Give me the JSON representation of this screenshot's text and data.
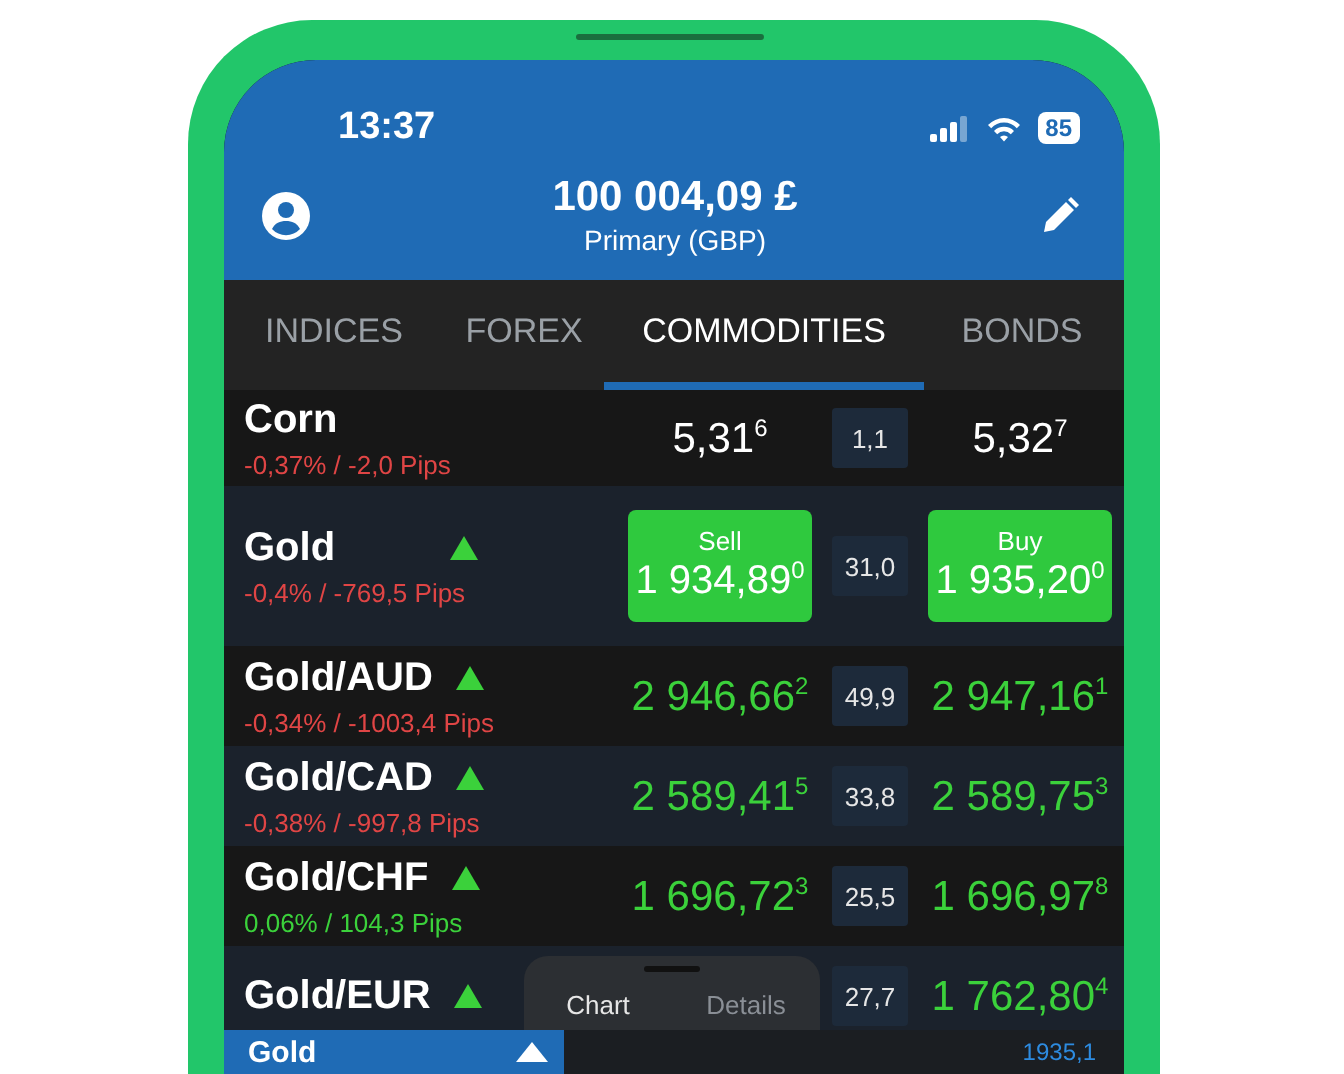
{
  "status_bar": {
    "time": "13:37",
    "battery": "85"
  },
  "header": {
    "balance": "100 004,09 £",
    "account": "Primary (GBP)"
  },
  "tabs": [
    {
      "label": "INDICES",
      "selected": false
    },
    {
      "label": "FOREX",
      "selected": false
    },
    {
      "label": "COMMODITIES",
      "selected": true
    },
    {
      "label": "BONDS",
      "selected": false
    }
  ],
  "rows": [
    {
      "name": "Corn",
      "change": "-0,37% / -2,0 Pips",
      "change_positive": false,
      "rising": false,
      "selected": false,
      "bid": "5,31",
      "bid_sup": "6",
      "spread": "1,1",
      "ask": "5,32",
      "ask_sup": "7"
    },
    {
      "name": "Gold",
      "change": "-0,4% / -769,5 Pips",
      "change_positive": false,
      "rising": true,
      "selected": true,
      "sell_label": "Sell",
      "buy_label": "Buy",
      "bid": "1 934,89",
      "bid_sup": "0",
      "spread": "31,0",
      "ask": "1 935,20",
      "ask_sup": "0"
    },
    {
      "name": "Gold/AUD",
      "change": "-0,34% / -1003,4 Pips",
      "change_positive": false,
      "rising": true,
      "selected": false,
      "bid": "2 946,66",
      "bid_sup": "2",
      "spread": "49,9",
      "ask": "2 947,16",
      "ask_sup": "1"
    },
    {
      "name": "Gold/CAD",
      "change": "-0,38% / -997,8 Pips",
      "change_positive": false,
      "rising": true,
      "selected": false,
      "bid": "2 589,41",
      "bid_sup": "5",
      "spread": "33,8",
      "ask": "2 589,75",
      "ask_sup": "3"
    },
    {
      "name": "Gold/CHF",
      "change": "0,06% / 104,3 Pips",
      "change_positive": true,
      "rising": true,
      "selected": false,
      "bid": "1 696,72",
      "bid_sup": "3",
      "spread": "25,5",
      "ask": "1 696,97",
      "ask_sup": "8"
    },
    {
      "name": "Gold/EUR",
      "rising": true,
      "selected": false,
      "spread": "27,7",
      "ask": "1 762,80",
      "ask_sup": "4"
    }
  ],
  "sheet_tabs": [
    {
      "label": "Chart",
      "selected": true
    },
    {
      "label": "Details",
      "selected": false
    }
  ],
  "bottom_bar": {
    "instrument": "Gold",
    "price": "1935,1"
  }
}
